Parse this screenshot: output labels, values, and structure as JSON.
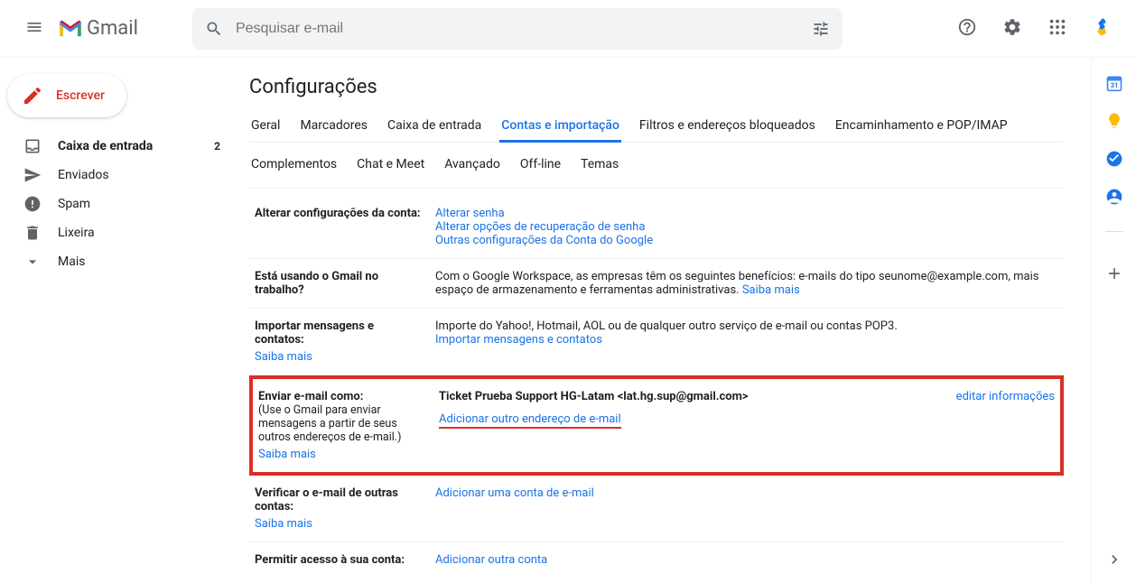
{
  "header": {
    "product": "Gmail",
    "search_placeholder": "Pesquisar e-mail"
  },
  "compose": {
    "label": "Escrever"
  },
  "nav": {
    "inbox": {
      "label": "Caixa de entrada",
      "count": "2"
    },
    "sent": {
      "label": "Enviados"
    },
    "spam": {
      "label": "Spam"
    },
    "trash": {
      "label": "Lixeira"
    },
    "more": {
      "label": "Mais"
    }
  },
  "settings": {
    "title": "Configurações",
    "tabs1": {
      "geral": "Geral",
      "marcadores": "Marcadores",
      "inbox": "Caixa de entrada",
      "contas": "Contas e importação",
      "filtros": "Filtros e endereços bloqueados",
      "forward": "Encaminhamento e POP/IMAP"
    },
    "tabs2": {
      "complementos": "Complementos",
      "chat": "Chat e Meet",
      "avancado": "Avançado",
      "offline": "Off-line",
      "temas": "Temas"
    },
    "row_account": {
      "label": "Alterar configurações da conta:",
      "link1": "Alterar senha",
      "link2": "Alterar opções de recuperação de senha",
      "link3": "Outras configurações da Conta do Google"
    },
    "row_workspace": {
      "label": "Está usando o Gmail no trabalho?",
      "text": "Com o Google Workspace, as empresas têm os seguintes benefícios: e-mails do tipo seunome@example.com, mais espaço de armazenamento e ferramentas administrativas. ",
      "link": "Saiba mais"
    },
    "row_import": {
      "label": "Importar mensagens e contatos:",
      "text": "Importe do Yahoo!, Hotmail, AOL ou de qualquer outro serviço de e-mail ou contas POP3.",
      "link": "Importar mensagens e contatos",
      "saiba": "Saiba mais"
    },
    "row_sendas": {
      "label": "Enviar e-mail como:",
      "sub": "(Use o Gmail para enviar mensagens a partir de seus outros endereços de e-mail.)",
      "saiba": "Saiba mais",
      "account": "Ticket Prueba Support HG-Latam <lat.hg.sup@gmail.com>",
      "edit": "editar informações",
      "add": "Adicionar outro endereço de e-mail"
    },
    "row_check": {
      "label": "Verificar o e-mail de outras contas:",
      "link": "Adicionar uma conta de e-mail",
      "saiba": "Saiba mais"
    },
    "row_grant": {
      "label": "Permitir acesso à sua conta:",
      "link": "Adicionar outra conta"
    }
  }
}
